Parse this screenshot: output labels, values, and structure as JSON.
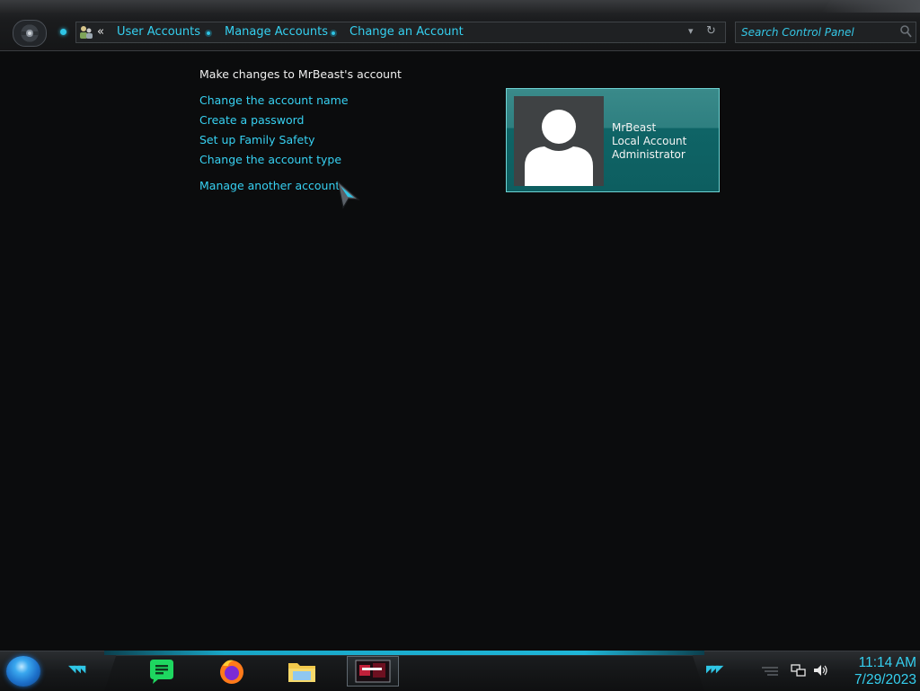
{
  "address_bar": {
    "back_chevrons": "«",
    "breadcrumbs": [
      "User Accounts",
      "Manage Accounts",
      "Change an Account"
    ]
  },
  "search": {
    "placeholder": "Search Control Panel"
  },
  "content": {
    "heading": "Make changes to MrBeast's account",
    "tasks": [
      "Change the account name",
      "Create a password",
      "Set up Family Safety",
      "Change the account type",
      "Manage another account"
    ]
  },
  "account": {
    "name": "MrBeast",
    "type": "Local Account",
    "role": "Administrator"
  },
  "taskbar": {
    "apps": [
      "spotify-icon",
      "firefox-icon",
      "file-explorer-icon",
      "active-window-thumbnail"
    ],
    "time": "11:14 AM",
    "date": "7/29/2023"
  },
  "colors": {
    "accent": "#35d0f0",
    "tile": "#1a6f70",
    "background": "#0b0c0d"
  }
}
